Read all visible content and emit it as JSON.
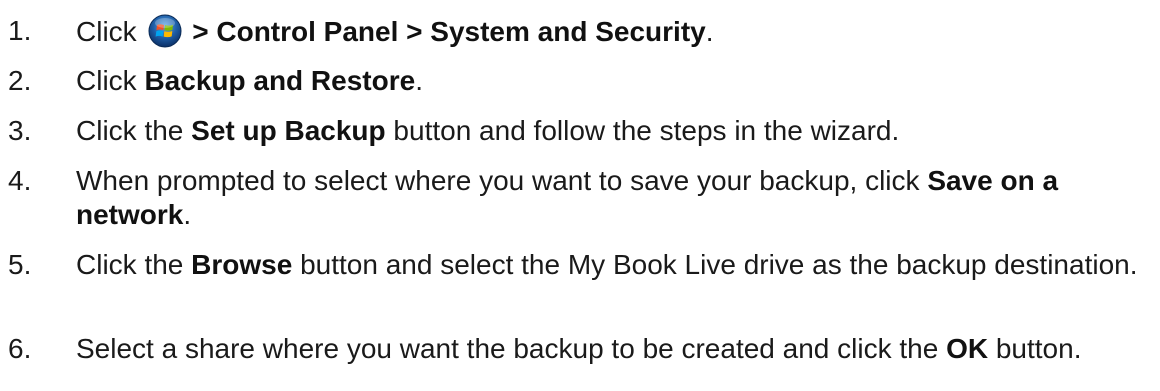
{
  "steps": [
    {
      "number": "1.",
      "parts": [
        {
          "text": "Click ",
          "bold": false
        },
        {
          "icon": "windows-start-icon"
        },
        {
          "text": " > Control Panel > System and Security",
          "bold": true
        },
        {
          "text": ".",
          "bold": false
        }
      ]
    },
    {
      "number": "2.",
      "parts": [
        {
          "text": "Click ",
          "bold": false
        },
        {
          "text": "Backup and Restore",
          "bold": true
        },
        {
          "text": ".",
          "bold": false
        }
      ]
    },
    {
      "number": "3.",
      "parts": [
        {
          "text": "Click the ",
          "bold": false
        },
        {
          "text": "Set up Backup",
          "bold": true
        },
        {
          "text": " button and follow the steps in the wizard.",
          "bold": false
        }
      ]
    },
    {
      "number": "4.",
      "parts": [
        {
          "text": "When prompted to select where you want to save your backup, click ",
          "bold": false
        },
        {
          "text": "Save on a network",
          "bold": true
        },
        {
          "text": ".",
          "bold": false
        }
      ]
    },
    {
      "number": "5.",
      "parts": [
        {
          "text": "Click the ",
          "bold": false
        },
        {
          "text": "Browse",
          "bold": true
        },
        {
          "text": " button and select the My Book Live drive as the backup destination.",
          "bold": false
        }
      ]
    },
    {
      "number": "6.",
      "parts": [
        {
          "text": "Select a share where you want the backup to be created and click the ",
          "bold": false
        },
        {
          "text": "OK",
          "bold": true
        },
        {
          "text": " button.",
          "bold": false
        }
      ]
    }
  ]
}
